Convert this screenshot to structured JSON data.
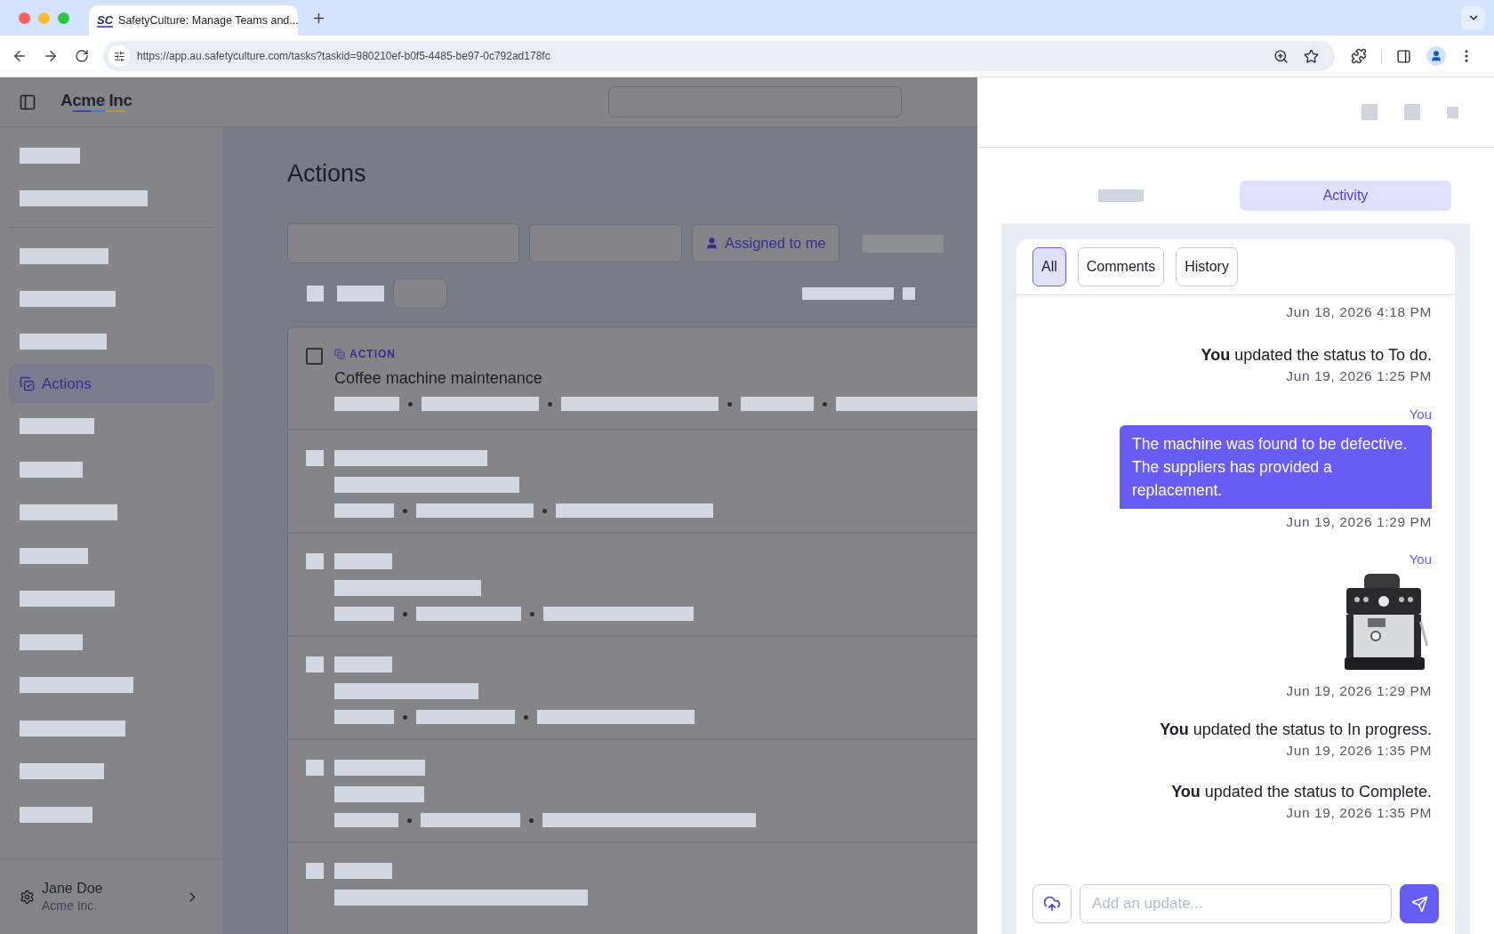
{
  "browser": {
    "favicon": "SC",
    "tab_title": "SafetyCulture: Manage Teams and...",
    "url": "https://app.au.safetyculture.com/tasks?taskid=980210ef-b0f5-4485-be97-0c792ad178fc"
  },
  "header": {
    "logo": "Acme Inc"
  },
  "sidebar": {
    "items": [
      {
        "label": "Actions",
        "selected": true
      }
    ],
    "user": {
      "name": "Jane Doe",
      "org": "Acme Inc."
    }
  },
  "main": {
    "title": "Actions",
    "assigned_button": "Assigned to me",
    "rows": [
      {
        "tag": "ACTION",
        "title": "Coffee machine maintenance",
        "checked": false
      }
    ]
  },
  "panel": {
    "tabs": [
      {
        "label": "Activity",
        "selected": true
      }
    ],
    "filters": [
      {
        "label": "All",
        "selected": true
      },
      {
        "label": "Comments",
        "selected": false
      },
      {
        "label": "History",
        "selected": false
      }
    ],
    "feed": [
      {
        "kind": "time",
        "time": "Jun 18, 2026 4:18 PM"
      },
      {
        "kind": "status",
        "text": "**You** updated the status to To do.",
        "time": "Jun 19, 2026 1:25 PM"
      },
      {
        "kind": "comment",
        "author": "You",
        "text": "The machine was found to be defective. The suppliers has provided a replacement.",
        "time": "Jun 19, 2026 1:29 PM"
      },
      {
        "author": "You",
        "time": "Jun 19, 2026 1:29 PM"
      },
      {
        "kind": "status",
        "text": "**You** updated the status to In progress.",
        "time": "Jun 19, 2026 1:35 PM"
      },
      {
        "kind": "status",
        "text": "**You** updated the status to Complete.",
        "time": "Jun 19, 2026 1:35 PM"
      }
    ],
    "input": {
      "placeholder": "Add an update..."
    }
  }
}
